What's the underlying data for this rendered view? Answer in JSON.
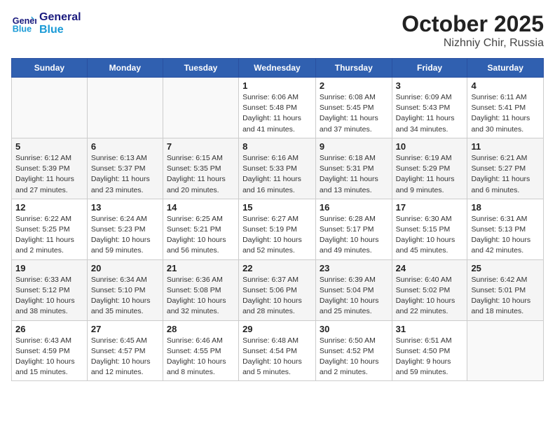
{
  "header": {
    "logo_line1": "General",
    "logo_line2": "Blue",
    "title": "October 2025",
    "subtitle": "Nizhniy Chir, Russia"
  },
  "weekdays": [
    "Sunday",
    "Monday",
    "Tuesday",
    "Wednesday",
    "Thursday",
    "Friday",
    "Saturday"
  ],
  "weeks": [
    [
      {
        "day": "",
        "detail": ""
      },
      {
        "day": "",
        "detail": ""
      },
      {
        "day": "",
        "detail": ""
      },
      {
        "day": "1",
        "detail": "Sunrise: 6:06 AM\nSunset: 5:48 PM\nDaylight: 11 hours\nand 41 minutes."
      },
      {
        "day": "2",
        "detail": "Sunrise: 6:08 AM\nSunset: 5:45 PM\nDaylight: 11 hours\nand 37 minutes."
      },
      {
        "day": "3",
        "detail": "Sunrise: 6:09 AM\nSunset: 5:43 PM\nDaylight: 11 hours\nand 34 minutes."
      },
      {
        "day": "4",
        "detail": "Sunrise: 6:11 AM\nSunset: 5:41 PM\nDaylight: 11 hours\nand 30 minutes."
      }
    ],
    [
      {
        "day": "5",
        "detail": "Sunrise: 6:12 AM\nSunset: 5:39 PM\nDaylight: 11 hours\nand 27 minutes."
      },
      {
        "day": "6",
        "detail": "Sunrise: 6:13 AM\nSunset: 5:37 PM\nDaylight: 11 hours\nand 23 minutes."
      },
      {
        "day": "7",
        "detail": "Sunrise: 6:15 AM\nSunset: 5:35 PM\nDaylight: 11 hours\nand 20 minutes."
      },
      {
        "day": "8",
        "detail": "Sunrise: 6:16 AM\nSunset: 5:33 PM\nDaylight: 11 hours\nand 16 minutes."
      },
      {
        "day": "9",
        "detail": "Sunrise: 6:18 AM\nSunset: 5:31 PM\nDaylight: 11 hours\nand 13 minutes."
      },
      {
        "day": "10",
        "detail": "Sunrise: 6:19 AM\nSunset: 5:29 PM\nDaylight: 11 hours\nand 9 minutes."
      },
      {
        "day": "11",
        "detail": "Sunrise: 6:21 AM\nSunset: 5:27 PM\nDaylight: 11 hours\nand 6 minutes."
      }
    ],
    [
      {
        "day": "12",
        "detail": "Sunrise: 6:22 AM\nSunset: 5:25 PM\nDaylight: 11 hours\nand 2 minutes."
      },
      {
        "day": "13",
        "detail": "Sunrise: 6:24 AM\nSunset: 5:23 PM\nDaylight: 10 hours\nand 59 minutes."
      },
      {
        "day": "14",
        "detail": "Sunrise: 6:25 AM\nSunset: 5:21 PM\nDaylight: 10 hours\nand 56 minutes."
      },
      {
        "day": "15",
        "detail": "Sunrise: 6:27 AM\nSunset: 5:19 PM\nDaylight: 10 hours\nand 52 minutes."
      },
      {
        "day": "16",
        "detail": "Sunrise: 6:28 AM\nSunset: 5:17 PM\nDaylight: 10 hours\nand 49 minutes."
      },
      {
        "day": "17",
        "detail": "Sunrise: 6:30 AM\nSunset: 5:15 PM\nDaylight: 10 hours\nand 45 minutes."
      },
      {
        "day": "18",
        "detail": "Sunrise: 6:31 AM\nSunset: 5:13 PM\nDaylight: 10 hours\nand 42 minutes."
      }
    ],
    [
      {
        "day": "19",
        "detail": "Sunrise: 6:33 AM\nSunset: 5:12 PM\nDaylight: 10 hours\nand 38 minutes."
      },
      {
        "day": "20",
        "detail": "Sunrise: 6:34 AM\nSunset: 5:10 PM\nDaylight: 10 hours\nand 35 minutes."
      },
      {
        "day": "21",
        "detail": "Sunrise: 6:36 AM\nSunset: 5:08 PM\nDaylight: 10 hours\nand 32 minutes."
      },
      {
        "day": "22",
        "detail": "Sunrise: 6:37 AM\nSunset: 5:06 PM\nDaylight: 10 hours\nand 28 minutes."
      },
      {
        "day": "23",
        "detail": "Sunrise: 6:39 AM\nSunset: 5:04 PM\nDaylight: 10 hours\nand 25 minutes."
      },
      {
        "day": "24",
        "detail": "Sunrise: 6:40 AM\nSunset: 5:02 PM\nDaylight: 10 hours\nand 22 minutes."
      },
      {
        "day": "25",
        "detail": "Sunrise: 6:42 AM\nSunset: 5:01 PM\nDaylight: 10 hours\nand 18 minutes."
      }
    ],
    [
      {
        "day": "26",
        "detail": "Sunrise: 6:43 AM\nSunset: 4:59 PM\nDaylight: 10 hours\nand 15 minutes."
      },
      {
        "day": "27",
        "detail": "Sunrise: 6:45 AM\nSunset: 4:57 PM\nDaylight: 10 hours\nand 12 minutes."
      },
      {
        "day": "28",
        "detail": "Sunrise: 6:46 AM\nSunset: 4:55 PM\nDaylight: 10 hours\nand 8 minutes."
      },
      {
        "day": "29",
        "detail": "Sunrise: 6:48 AM\nSunset: 4:54 PM\nDaylight: 10 hours\nand 5 minutes."
      },
      {
        "day": "30",
        "detail": "Sunrise: 6:50 AM\nSunset: 4:52 PM\nDaylight: 10 hours\nand 2 minutes."
      },
      {
        "day": "31",
        "detail": "Sunrise: 6:51 AM\nSunset: 4:50 PM\nDaylight: 9 hours\nand 59 minutes."
      },
      {
        "day": "",
        "detail": ""
      }
    ]
  ]
}
